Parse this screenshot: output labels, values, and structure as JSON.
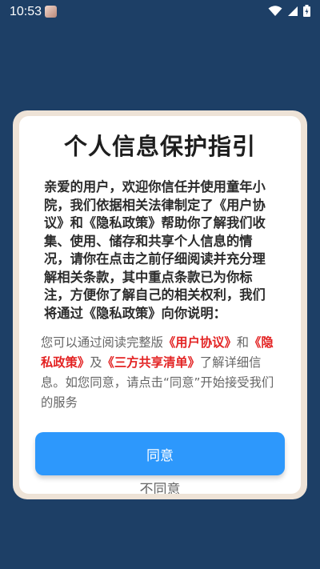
{
  "status_bar": {
    "time": "10:53",
    "icons": [
      "avatar-icon",
      "wifi-icon",
      "signal-icon",
      "battery-charging-icon"
    ]
  },
  "dialog": {
    "title": "个人信息保护指引",
    "intro": "亲爱的用户，欢迎你信任并使用童年小院，我们依据相关法律制定了《用户协议》和《隐私政策》帮助你了解我们收集、使用、储存和共享个人信息的情况，请你在点击之前仔细阅读并充分理解相关条款，其中重点条款已为你标注，方便你了解自己的相关权利，我们将通过《隐私政策》向你说明：",
    "consent": {
      "prefix": "您可以通过阅读完整版",
      "user_agreement": "《用户协议》",
      "and": "和",
      "privacy_policy": "《隐私政策》",
      "and2": "及",
      "third_party_list": "《三方共享清单》",
      "suffix": "了解详细信息。如您同意，请点击“同意”开始接受我们的服务"
    },
    "agree_label": "同意",
    "disagree_label": "不同意"
  },
  "colors": {
    "background": "#1d3f66",
    "accent": "#2d98fc",
    "link": "#e32323",
    "frame": "#eee3d7"
  }
}
